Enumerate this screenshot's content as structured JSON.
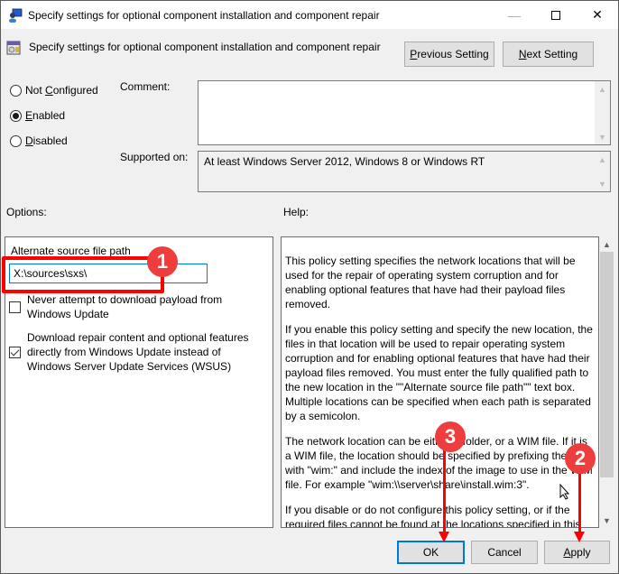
{
  "window": {
    "title": "Specify settings for optional component installation and component repair",
    "icon": "group-policy-icon",
    "controls": {
      "minimize": "—",
      "maximize": "maximize-icon",
      "close": "✕"
    }
  },
  "header": {
    "setting_title": "Specify settings for optional component installation and component repair",
    "setting_icon": "policy-setting-icon",
    "previous_button": {
      "accel": "P",
      "rest": "revious Setting"
    },
    "next_button": {
      "accel": "N",
      "rest": "ext Setting"
    }
  },
  "state": {
    "options": [
      {
        "pre": "Not ",
        "accel": "C",
        "post": "onfigured",
        "checked": false
      },
      {
        "pre": "",
        "accel": "E",
        "post": "nabled",
        "checked": true
      },
      {
        "pre": "",
        "accel": "D",
        "post": "isabled",
        "checked": false
      }
    ]
  },
  "comment": {
    "label": "Comment:",
    "value": ""
  },
  "supported": {
    "label": "Supported on:",
    "value": "At least Windows Server 2012, Windows 8 or Windows RT"
  },
  "options_panel": {
    "heading": "Options:",
    "path_label": "Alternate source file path",
    "path_value": "X:\\sources\\sxs\\",
    "checkboxes": [
      {
        "label": "Never attempt to download payload from Windows Update",
        "checked": false
      },
      {
        "label": "Download repair content and optional features directly from Windows Update instead of Windows Server Update Services (WSUS)",
        "checked": true
      }
    ]
  },
  "help_panel": {
    "heading": "Help:",
    "paragraphs": [
      "This policy setting specifies the network locations that will be used for the repair of operating system corruption and for enabling optional features that have had their payload files removed.",
      "If you enable this policy setting and specify the new location, the files in that location will be used to repair operating system corruption and for enabling optional features that have had their payload files removed. You must enter the fully qualified path to the new location in the \"\"Alternate source file path\"\" text box. Multiple locations can be specified when each path is separated by a semicolon.",
      "The network location can be either a folder, or a WIM file. If it is a WIM file, the location should be specified by prefixing the path with \"wim:\" and include the index of the image to use in the WIM file. For example \"wim:\\\\server\\share\\install.wim:3\".",
      "If you disable or do not configure this policy setting, or if the required files cannot be found at the locations specified in this policy setting, the files will be downloaded from Windows Update."
    ],
    "scroll_position": 0.0
  },
  "footer": {
    "ok": "OK",
    "cancel": "Cancel",
    "apply": {
      "accel": "A",
      "rest": "pply"
    }
  },
  "annotations": {
    "badges": [
      "1",
      "2",
      "3"
    ],
    "color": "#ee3d3d"
  }
}
